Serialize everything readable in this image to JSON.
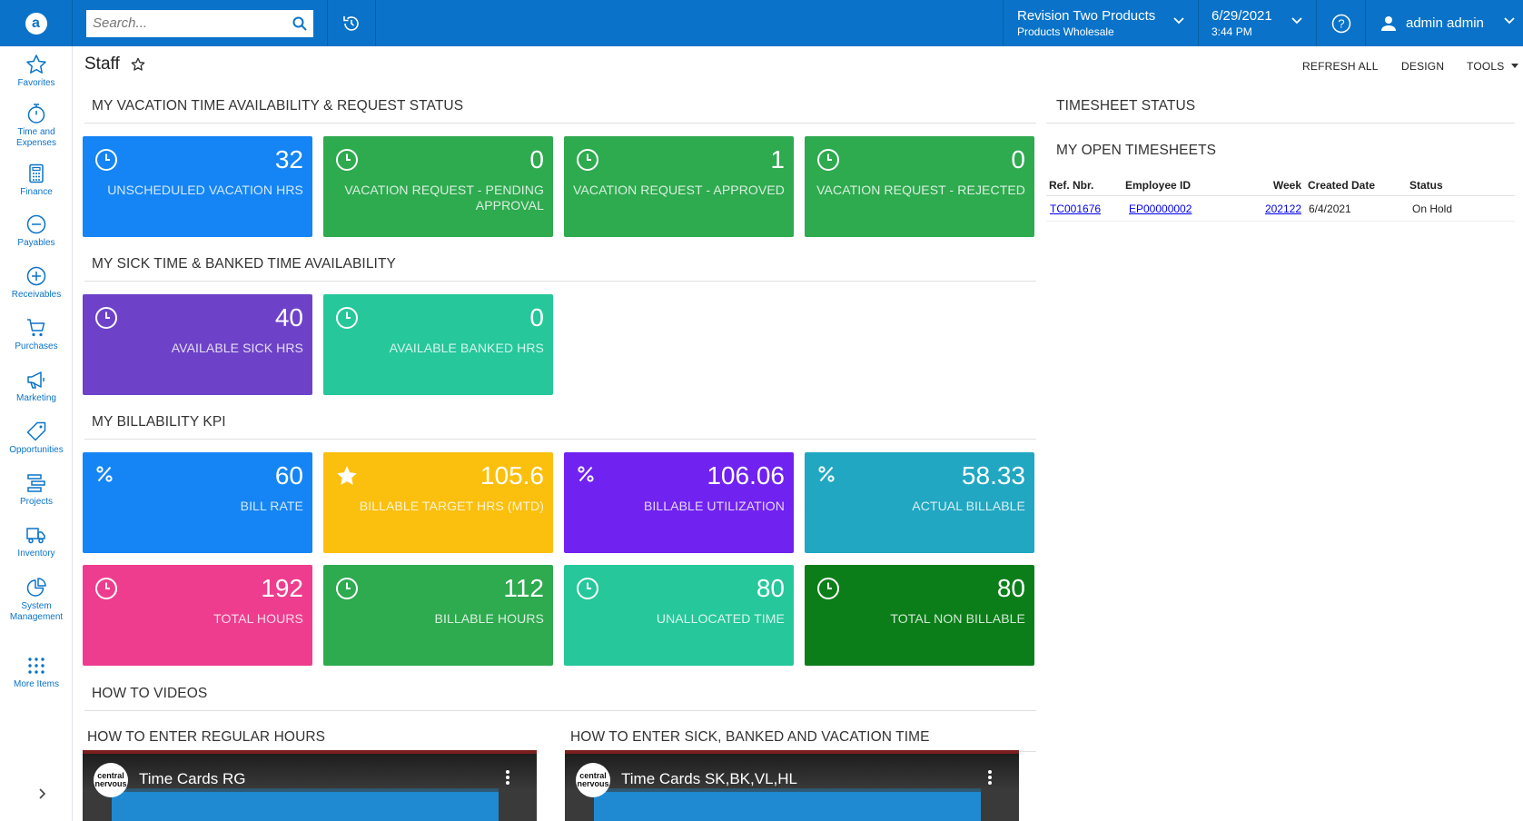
{
  "topbar": {
    "search_placeholder": "Search...",
    "company_name": "Revision Two Products",
    "company_branch": "Products Wholesale",
    "date": "6/29/2021",
    "time": "3:44 PM",
    "user": "admin admin",
    "brand_color": "#0a73c9"
  },
  "sidebar": {
    "items": [
      {
        "label": "Favorites",
        "icon": "star-icon"
      },
      {
        "label": "Time and Expenses",
        "icon": "stopwatch-icon"
      },
      {
        "label": "Finance",
        "icon": "calculator-icon"
      },
      {
        "label": "Payables",
        "icon": "minus-circle-icon"
      },
      {
        "label": "Receivables",
        "icon": "plus-circle-icon"
      },
      {
        "label": "Purchases",
        "icon": "cart-icon"
      },
      {
        "label": "Marketing",
        "icon": "megaphone-icon"
      },
      {
        "label": "Opportunities",
        "icon": "tag-icon"
      },
      {
        "label": "Projects",
        "icon": "projects-icon"
      },
      {
        "label": "Inventory",
        "icon": "truck-icon"
      },
      {
        "label": "System Management",
        "icon": "pie-icon"
      },
      {
        "label": "More Items",
        "icon": "grid-icon"
      }
    ]
  },
  "page": {
    "title": "Staff",
    "refresh_all": "REFRESH ALL",
    "design": "DESIGN",
    "tools": "TOOLS"
  },
  "sections": {
    "vacation": "MY VACATION TIME AVAILABILITY & REQUEST STATUS",
    "sick": "MY SICK TIME & BANKED TIME AVAILABILITY",
    "billability": "MY BILLABILITY KPI",
    "videos": "HOW TO VIDEOS",
    "timesheet_status": "TIMESHEET STATUS",
    "open_timesheets": "MY OPEN TIMESHEETS"
  },
  "tiles": {
    "vacation": [
      {
        "value": "32",
        "label": "UNSCHEDULED VACATION HRS",
        "icon": "clock-icon",
        "color": "#1585f5"
      },
      {
        "value": "0",
        "label": "VACATION REQUEST - PENDING APPROVAL",
        "icon": "clock-icon",
        "color": "#2eaa4f"
      },
      {
        "value": "1",
        "label": "VACATION REQUEST - APPROVED",
        "icon": "clock-icon",
        "color": "#2eaa4f"
      },
      {
        "value": "0",
        "label": "VACATION REQUEST - REJECTED",
        "icon": "clock-icon",
        "color": "#2eaa4f"
      }
    ],
    "sick": [
      {
        "value": "40",
        "label": "AVAILABLE SICK HRS",
        "icon": "clock-icon",
        "color": "#6d42c8"
      },
      {
        "value": "0",
        "label": "AVAILABLE BANKED HRS",
        "icon": "clock-icon",
        "color": "#25c79b"
      }
    ],
    "kpi_row1": [
      {
        "value": "60",
        "label": "BILL RATE",
        "icon": "percent-icon",
        "color": "#1585f5"
      },
      {
        "value": "105.6",
        "label": "BILLABLE TARGET HRS (MTD)",
        "icon": "star-icon",
        "color": "#fbbf0e"
      },
      {
        "value": "106.06",
        "label": "BILLABLE UTILIZATION",
        "icon": "percent-icon",
        "color": "#7022f0"
      },
      {
        "value": "58.33",
        "label": "ACTUAL BILLABLE",
        "icon": "percent-icon",
        "color": "#21a7c1"
      }
    ],
    "kpi_row2": [
      {
        "value": "192",
        "label": "TOTAL HOURS",
        "icon": "clock-icon",
        "color": "#ee3d8e"
      },
      {
        "value": "112",
        "label": "BILLABLE HOURS",
        "icon": "clock-icon",
        "color": "#2eaa4f"
      },
      {
        "value": "80",
        "label": "UNALLOCATED TIME",
        "icon": "clock-icon",
        "color": "#25c79b"
      },
      {
        "value": "80",
        "label": "TOTAL NON BILLABLE",
        "icon": "clock-icon",
        "color": "#0b7e19"
      }
    ]
  },
  "timesheets": {
    "headers": [
      "Ref. Nbr.",
      "Employee ID",
      "Week",
      "Created Date",
      "Status"
    ],
    "rows": [
      {
        "ref": "TC001676",
        "employee": "EP00000002",
        "week": "202122",
        "created": "6/4/2021",
        "status": "On Hold"
      }
    ]
  },
  "videos": [
    {
      "heading": "HOW TO ENTER REGULAR HOURS",
      "title": "Time Cards RG",
      "channel": "central nervous systems"
    },
    {
      "heading": "HOW TO ENTER SICK, BANKED AND VACATION TIME",
      "title": "Time Cards SK,BK,VL,HL",
      "channel": "central nervous systems"
    }
  ]
}
